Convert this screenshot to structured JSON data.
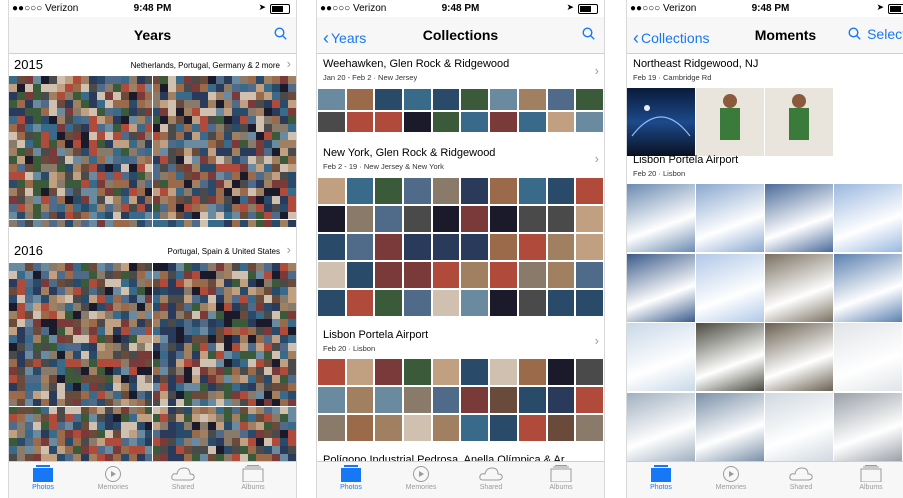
{
  "status": {
    "carrier": "●●○○○ Verizon",
    "time": "9:48 PM"
  },
  "tabs": [
    "Photos",
    "Memories",
    "Shared",
    "Albums"
  ],
  "screen1": {
    "title": "Years",
    "years": [
      {
        "year": "2015",
        "places": "Netherlands, Portugal, Germany & 2 more"
      },
      {
        "year": "2016",
        "places": "Portugal, Spain & United States"
      }
    ]
  },
  "screen2": {
    "back": "Years",
    "title": "Collections",
    "collections": [
      {
        "title": "Weehawken, Glen Rock & Ridgewood",
        "sub": "Jan 20 - Feb 2 · New Jersey"
      },
      {
        "title": "New York, Glen Rock & Ridgewood",
        "sub": "Feb 2 - 19 · New Jersey & New York"
      },
      {
        "title": "Lisbon Portela Airport",
        "sub": "Feb 20 · Lisbon"
      },
      {
        "title": "Polígono Industrial Pedrosa, Anella Olímpica & Ar…",
        "sub": ""
      }
    ]
  },
  "screen3": {
    "back": "Collections",
    "title": "Moments",
    "select": "Select",
    "moments": [
      {
        "title": "Northeast Ridgewood, NJ",
        "sub": "Feb 19 · Cambridge Rd"
      },
      {
        "title": "Lisbon Portela Airport",
        "sub": "Feb 20 · Lisbon"
      }
    ]
  },
  "colors": {
    "accent": "#1678f5",
    "bar": "#f7f7f7",
    "inactive": "#9b9b9b"
  },
  "icons": [
    "search-icon",
    "chevron-left-icon",
    "chevron-right-icon",
    "photos-tab-icon",
    "memories-tab-icon",
    "shared-tab-icon",
    "albums-tab-icon"
  ]
}
